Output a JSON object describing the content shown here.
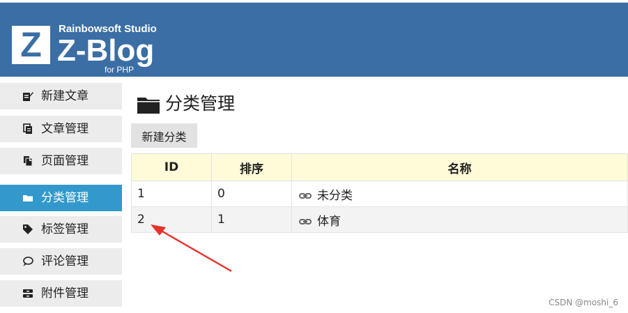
{
  "header": {
    "logo_letter": "Z",
    "studio": "Rainbowsoft Studio",
    "brand": "Z-Blog",
    "sub": "for PHP"
  },
  "sidebar": {
    "items": [
      {
        "label": "新建文章",
        "icon": "edit-icon"
      },
      {
        "label": "文章管理",
        "icon": "article-icon"
      },
      {
        "label": "页面管理",
        "icon": "page-icon"
      },
      {
        "label": "分类管理",
        "icon": "folder-icon",
        "active": true
      },
      {
        "label": "标签管理",
        "icon": "tag-icon"
      },
      {
        "label": "评论管理",
        "icon": "comment-icon"
      },
      {
        "label": "附件管理",
        "icon": "attachment-icon"
      }
    ]
  },
  "main": {
    "title": "分类管理",
    "new_button": "新建分类",
    "table": {
      "headers": [
        "ID",
        "排序",
        "名称"
      ],
      "rows": [
        {
          "id": "1",
          "order": "0",
          "name": "未分类"
        },
        {
          "id": "2",
          "order": "1",
          "name": "体育"
        }
      ]
    }
  },
  "watermark": "CSDN @moshi_6",
  "colors": {
    "header_bg": "#3a6ea5",
    "active_item": "#3399cc",
    "table_header": "#fffbd8",
    "annotation_arrow": "#e8322c"
  }
}
